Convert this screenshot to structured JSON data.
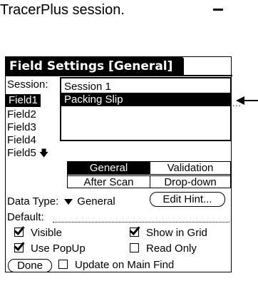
{
  "caption": "TracerPlus session.",
  "palm": {
    "title": "Field Settings [General]",
    "session_label": "Session:",
    "session_options": [
      "Session 1",
      "Packing Slip"
    ],
    "session_selected": "Packing Slip",
    "fields": [
      "Field1",
      "Field2",
      "Field3",
      "Field4",
      "Field5"
    ],
    "selected_field": "Field1",
    "tabs": {
      "general": "General",
      "validation": "Validation",
      "after_scan": "After Scan",
      "dropdown": "Drop-down"
    },
    "data_type_label": "Data Type:",
    "data_type_value": "General",
    "edit_hint": "Edit Hint...",
    "default_label": "Default:",
    "checkboxes": {
      "visible": {
        "label": "Visible",
        "checked": true
      },
      "show_in_grid": {
        "label": "Show in Grid",
        "checked": true
      },
      "use_popup": {
        "label": "Use PopUp",
        "checked": true
      },
      "read_only": {
        "label": "Read Only",
        "checked": false
      },
      "update_main_find": {
        "label": "Update on Main Find",
        "checked": false
      }
    },
    "done": "Done"
  }
}
